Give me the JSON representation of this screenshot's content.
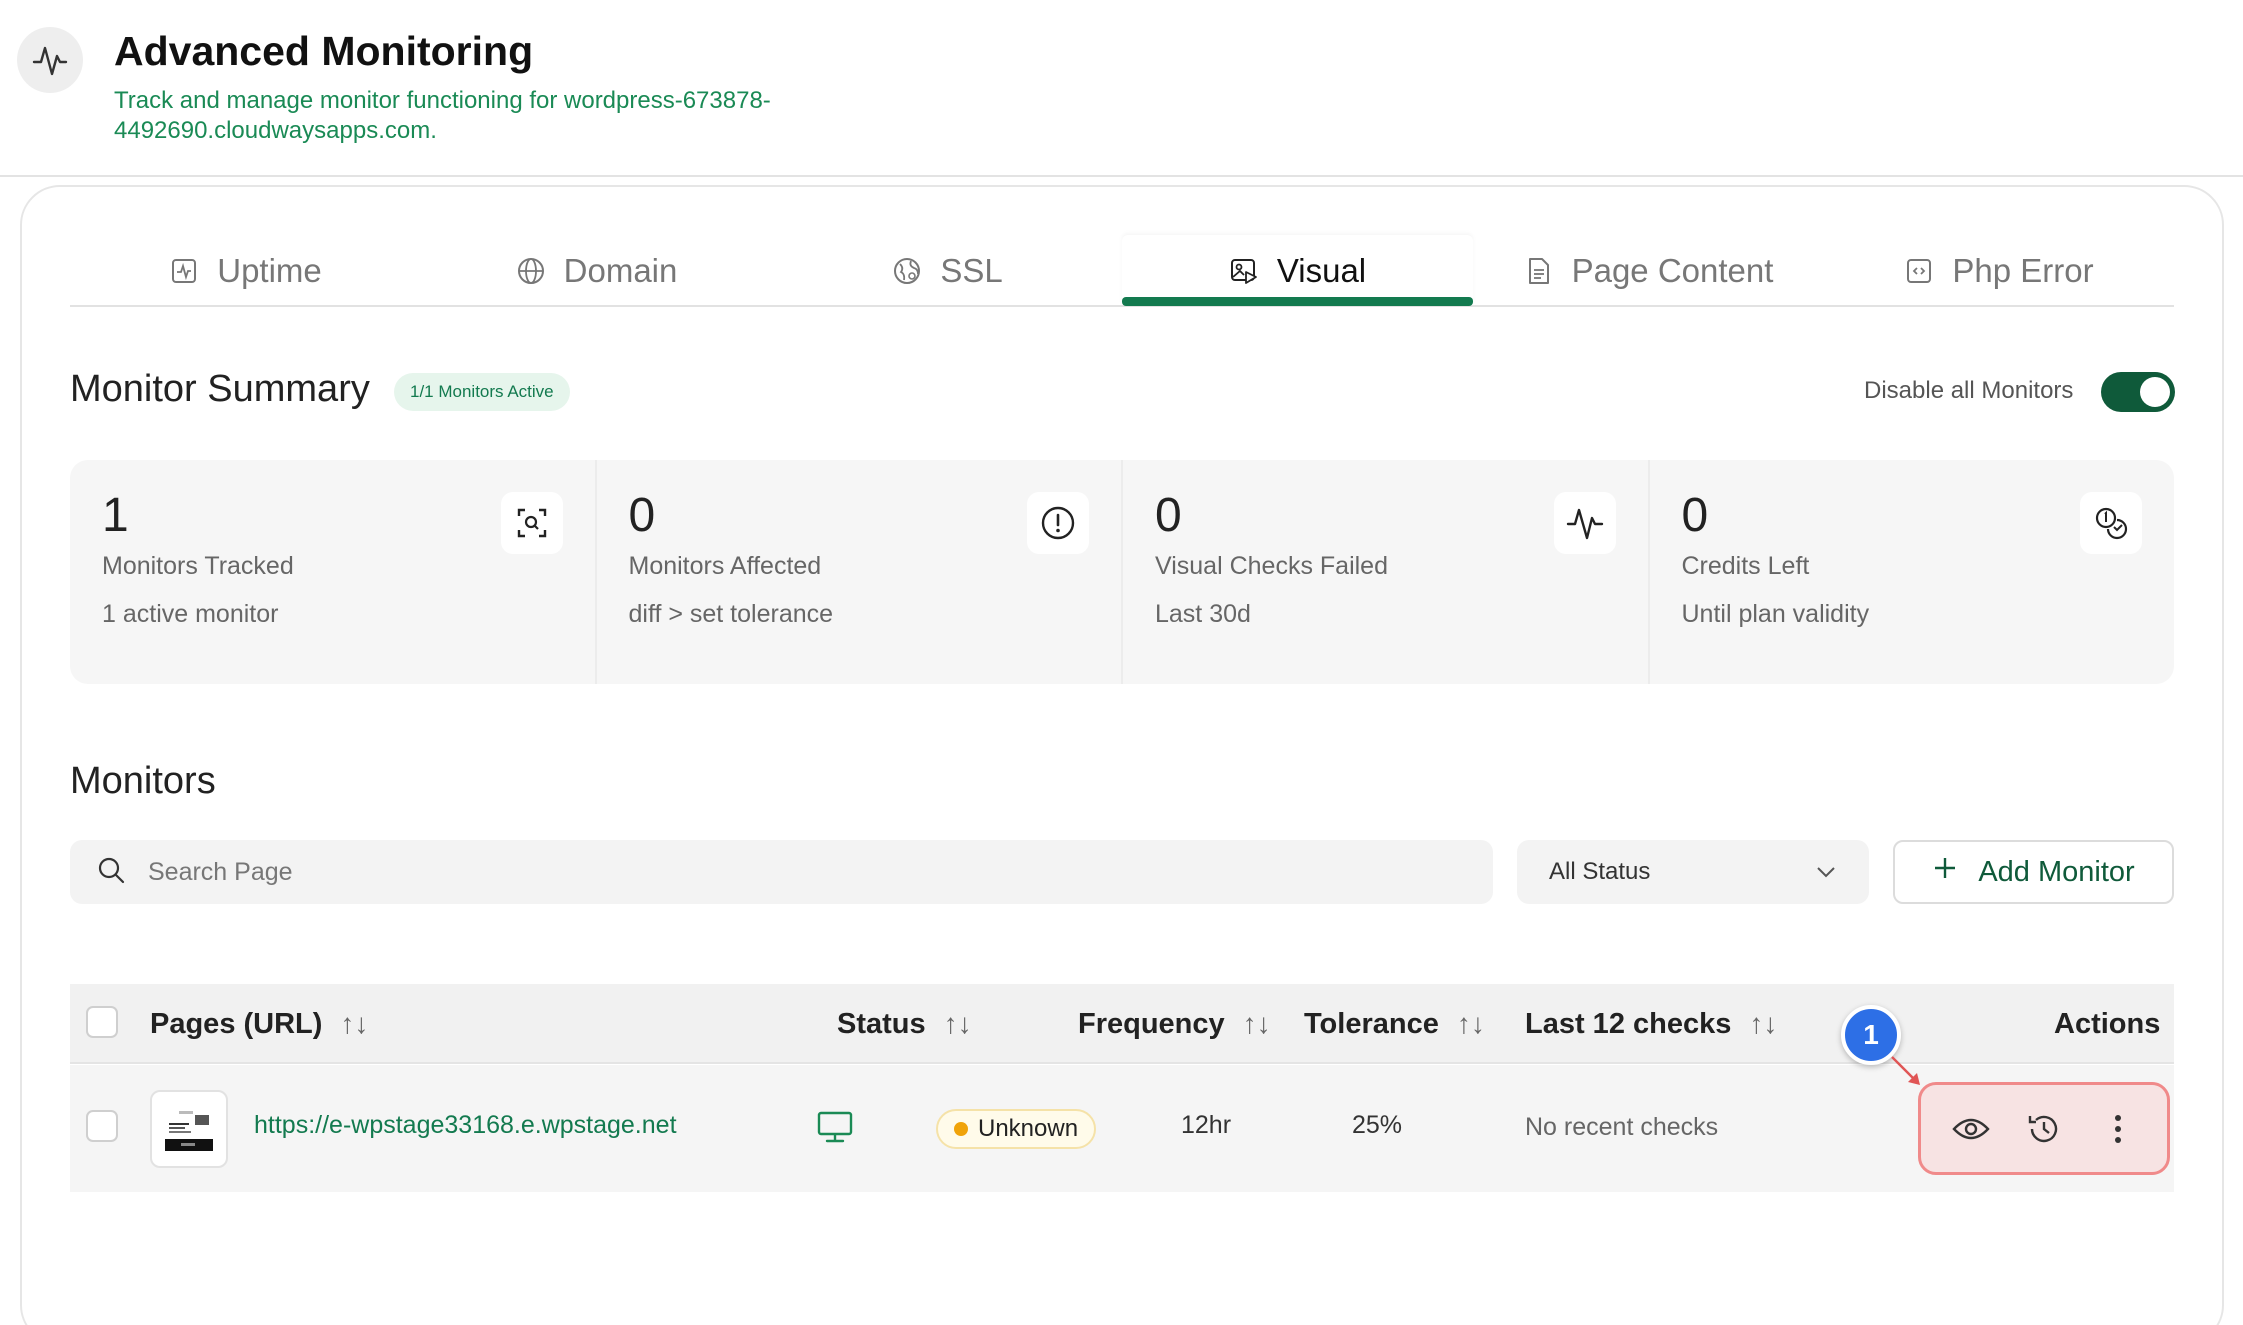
{
  "header": {
    "title": "Advanced Monitoring",
    "subtitle": "Track and manage monitor functioning for wordpress-673878-4492690.cloudwaysapps.com.",
    "icon": "pulse-icon"
  },
  "tabs": [
    {
      "label": "Uptime",
      "icon": "uptime-icon",
      "active": false
    },
    {
      "label": "Domain",
      "icon": "globe-icon",
      "active": false
    },
    {
      "label": "SSL",
      "icon": "ssl-globe-icon",
      "active": false
    },
    {
      "label": "Visual",
      "icon": "visual-image-icon",
      "active": true
    },
    {
      "label": "Page Content",
      "icon": "document-icon",
      "active": false
    },
    {
      "label": "Php Error",
      "icon": "code-icon",
      "active": false
    }
  ],
  "summary": {
    "title": "Monitor Summary",
    "badge": "1/1 Monitors Active",
    "disable_label": "Disable all Monitors",
    "toggle_on": true
  },
  "stats": [
    {
      "value": "1",
      "label": "Monitors Tracked",
      "sub": "1 active monitor",
      "icon": "scan-search-icon"
    },
    {
      "value": "0",
      "label": "Monitors Affected",
      "sub": "diff > set tolerance",
      "icon": "alert-circle-icon"
    },
    {
      "value": "0",
      "label": "Visual Checks Failed",
      "sub": "Last 30d",
      "icon": "pulse-icon"
    },
    {
      "value": "0",
      "label": "Credits Left",
      "sub": "Until plan validity",
      "icon": "coins-icon"
    }
  ],
  "monitors": {
    "title": "Monitors",
    "search_placeholder": "Search Page",
    "status_filter": "All Status",
    "add_button": "Add Monitor"
  },
  "table": {
    "columns": {
      "pages": "Pages (URL)",
      "status": "Status",
      "frequency": "Frequency",
      "tolerance": "Tolerance",
      "last_checks": "Last 12 checks",
      "actions": "Actions"
    },
    "rows": [
      {
        "url": "https://e-wpstage33168.e.wpstage.net",
        "device": "desktop-icon",
        "status": "Unknown",
        "frequency": "12hr",
        "tolerance": "25%",
        "last_checks": "No recent checks"
      }
    ]
  },
  "annotation": {
    "marker": "1"
  },
  "colors": {
    "brand_green": "#137a4f",
    "toggle_green": "#0f5a3a",
    "status_unknown": "#f0a30a",
    "marker_blue": "#2d6fe6",
    "highlight_red": "#f08a8a"
  }
}
